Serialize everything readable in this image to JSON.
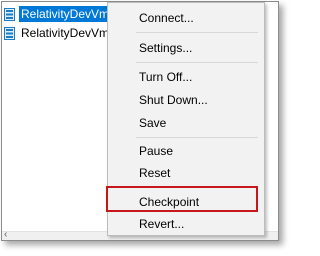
{
  "vm_list": {
    "rows": [
      {
        "name": "RelativityDevVm-",
        "icon": "vm-icon",
        "selected": true
      },
      {
        "name": "RelativityDevVm-",
        "icon": "vm-icon",
        "selected": false
      }
    ]
  },
  "context_menu": {
    "items": [
      {
        "label": "Connect..."
      },
      {
        "label": "Settings..."
      },
      {
        "label": "Turn Off..."
      },
      {
        "label": "Shut Down..."
      },
      {
        "label": "Save"
      },
      {
        "label": "Pause"
      },
      {
        "label": "Reset"
      },
      {
        "label": "Checkpoint"
      },
      {
        "label": "Revert..."
      }
    ]
  },
  "colors": {
    "selection": "#0078d7",
    "highlight_border": "#c8161d",
    "menu_background": "#f2f2f2"
  },
  "scrollbar": {
    "left_arrow_icon": "chevron-left-icon"
  }
}
